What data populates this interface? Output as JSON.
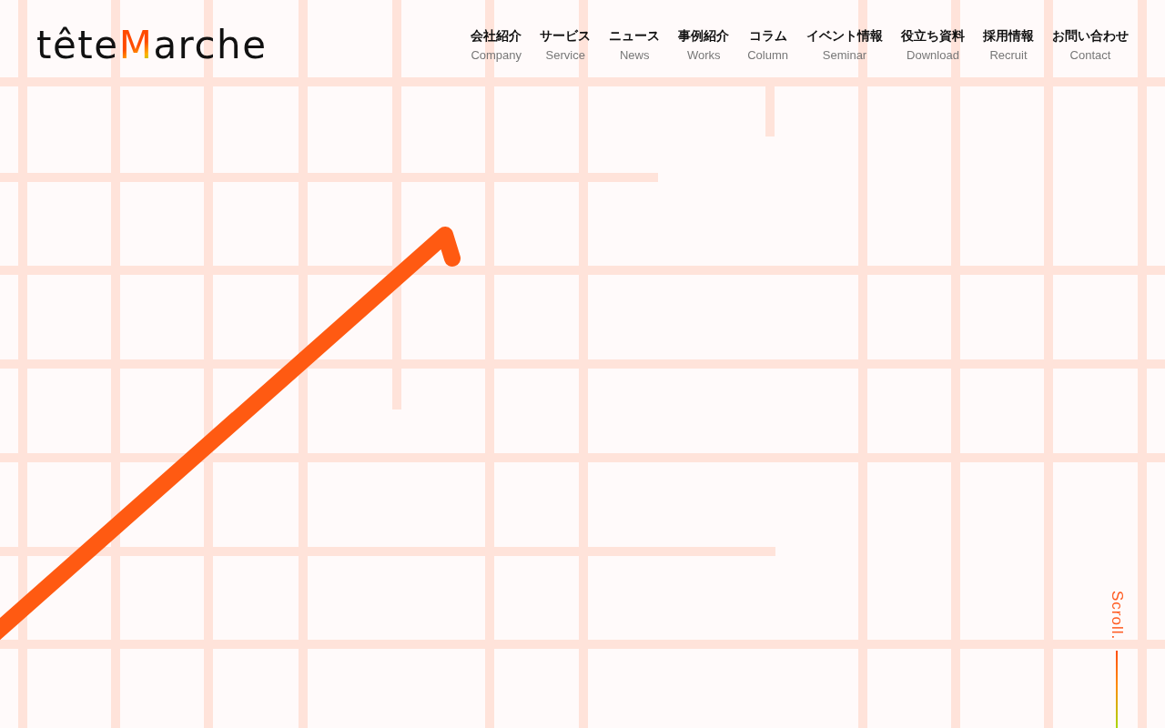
{
  "header": {
    "logo": {
      "parts": [
        {
          "text": "tête",
          "kind": "plain"
        },
        {
          "text": "M",
          "kind": "accent"
        },
        {
          "text": "arche",
          "kind": "plain"
        }
      ]
    },
    "nav": [
      {
        "label": "会社紹介",
        "sublabel": "Company"
      },
      {
        "label": "サービス",
        "sublabel": "Service"
      },
      {
        "label": "ニュース",
        "sublabel": "News"
      },
      {
        "label": "事例紹介",
        "sublabel": "Works"
      },
      {
        "label": "コラム",
        "sublabel": "Column"
      },
      {
        "label": "イベント情報",
        "sublabel": "Seminar"
      },
      {
        "label": "役立ち資料",
        "sublabel": "Download"
      },
      {
        "label": "採用情報",
        "sublabel": "Recruit"
      },
      {
        "label": "お問い合わせ",
        "sublabel": "Contact"
      }
    ]
  },
  "scroll_indicator": {
    "label": "Scroll."
  }
}
